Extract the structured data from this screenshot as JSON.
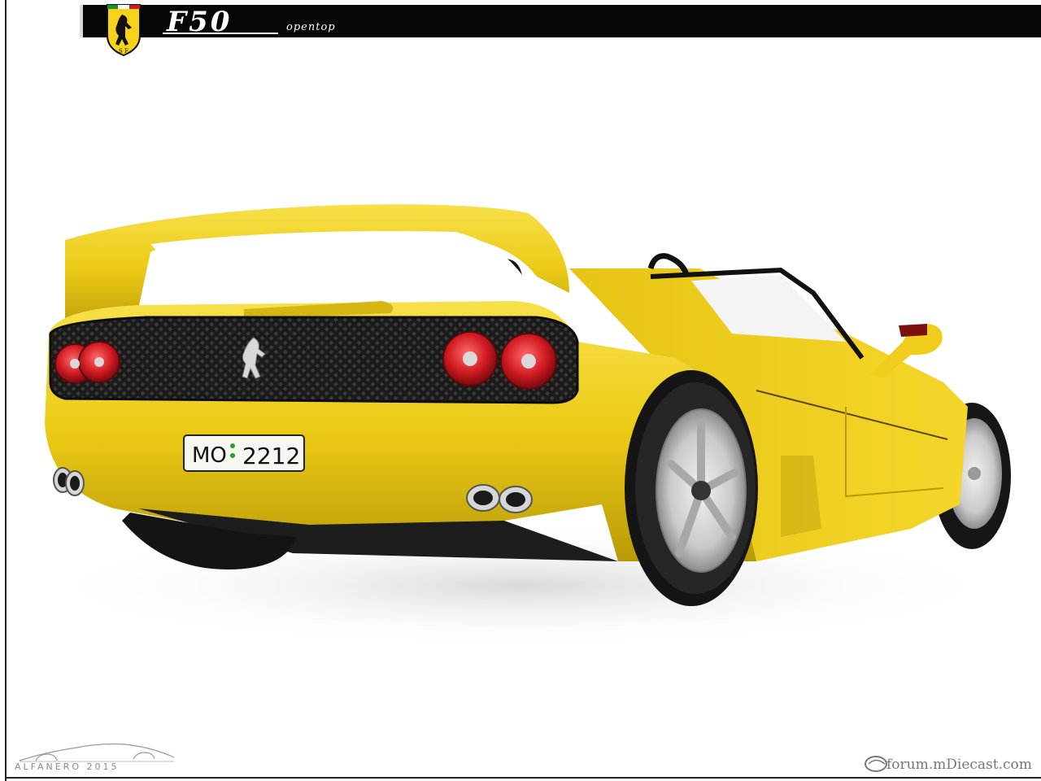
{
  "header": {
    "model": "F50",
    "variant": "opentop"
  },
  "car": {
    "plate": {
      "left": "MO",
      "right": "2212"
    },
    "body_color": "#f2d21c",
    "grille_color": "#1a1a1a",
    "taillight_color": "#c8101a"
  },
  "watermarks": {
    "left": "ALFANERO 2015",
    "right": "forum.mDiecast.com"
  },
  "icons": {
    "shield": "ferrari-shield-icon",
    "horse": "prancing-horse-icon"
  }
}
